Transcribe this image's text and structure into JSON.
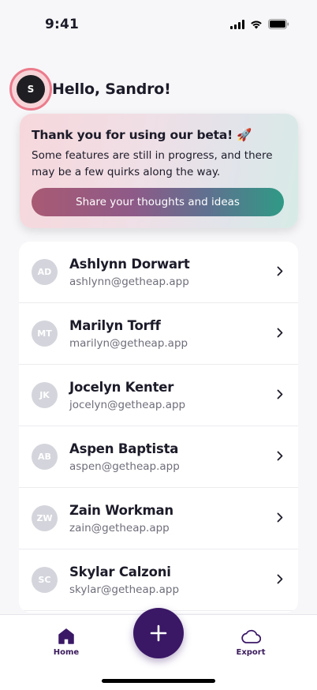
{
  "status_bar": {
    "time": "9:41"
  },
  "greeting": {
    "avatar_initial": "S",
    "text": "Hello, Sandro!"
  },
  "beta_card": {
    "title": "Thank you for using our beta! 🚀",
    "body": "Some features are still in progress, and there may be a few quirks along the way.",
    "button_label": "Share your thoughts and ideas"
  },
  "contacts": [
    {
      "initials": "AD",
      "name": "Ashlynn Dorwart",
      "email": "ashlynn@getheap.app"
    },
    {
      "initials": "MT",
      "name": "Marilyn Torff",
      "email": "marilyn@getheap.app"
    },
    {
      "initials": "JK",
      "name": "Jocelyn Kenter",
      "email": "jocelyn@getheap.app"
    },
    {
      "initials": "AB",
      "name": "Aspen Baptista",
      "email": "aspen@getheap.app"
    },
    {
      "initials": "ZW",
      "name": "Zain Workman",
      "email": "zain@getheap.app"
    },
    {
      "initials": "SC",
      "name": "Skylar Calzoni",
      "email": "skylar@getheap.app"
    }
  ],
  "bottom_nav": {
    "home_label": "Home",
    "export_label": "Export",
    "add_icon": "plus-icon"
  },
  "colors": {
    "accent": "#3a1866",
    "avatar_ring": "#ec7b8c"
  }
}
